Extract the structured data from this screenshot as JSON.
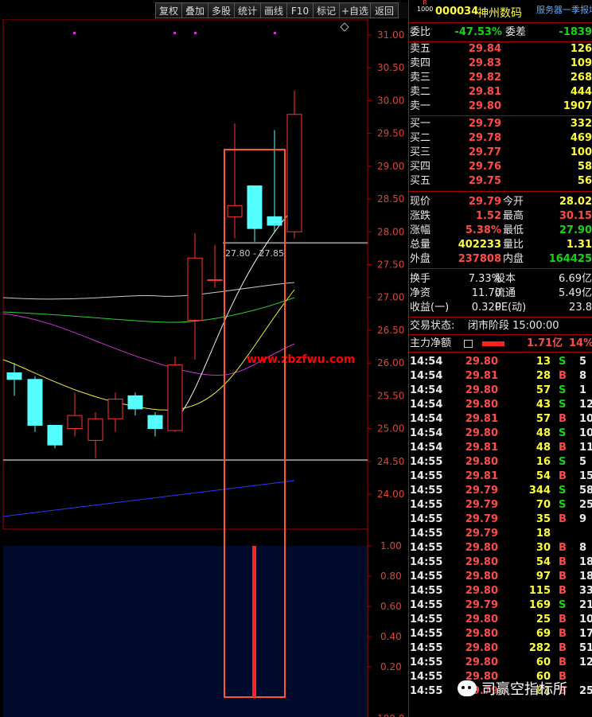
{
  "toolbar": [
    "复权",
    "叠加",
    "多股",
    "统计",
    "画线",
    "F10",
    "标记",
    "+自选",
    "返回"
  ],
  "stock": {
    "code": "000034",
    "name": "神州数码",
    "market_tag": "R\n1000",
    "server_label": "服务器一季报增"
  },
  "order_book_top": [
    {
      "label": "委比",
      "value": "-47.53%",
      "label2": "委差",
      "value2": "-1839"
    }
  ],
  "asks": [
    {
      "label": "卖五",
      "price": "29.84",
      "vol": "126"
    },
    {
      "label": "卖四",
      "price": "29.83",
      "vol": "109"
    },
    {
      "label": "卖三",
      "price": "29.82",
      "vol": "268"
    },
    {
      "label": "卖二",
      "price": "29.81",
      "vol": "444"
    },
    {
      "label": "卖一",
      "price": "29.80",
      "vol": "1907"
    }
  ],
  "bids": [
    {
      "label": "买一",
      "price": "29.79",
      "vol": "332"
    },
    {
      "label": "买二",
      "price": "29.78",
      "vol": "469"
    },
    {
      "label": "买三",
      "price": "29.77",
      "vol": "100"
    },
    {
      "label": "买四",
      "price": "29.76",
      "vol": "58"
    },
    {
      "label": "买五",
      "price": "29.75",
      "vol": "56"
    }
  ],
  "quote": [
    {
      "l1": "现价",
      "v1": "29.79",
      "l2": "今开",
      "v2": "28.02"
    },
    {
      "l1": "涨跌",
      "v1": "1.52",
      "l2": "最高",
      "v2": "30.15"
    },
    {
      "l1": "涨幅",
      "v1": "5.38%",
      "l2": "最低",
      "v2": "27.90"
    },
    {
      "l1": "总量",
      "v1": "402233",
      "l2": "量比",
      "v2": "1.31"
    },
    {
      "l1": "外盘",
      "v1": "237808",
      "l2": "内盘",
      "v2": "164425"
    }
  ],
  "stats": [
    {
      "l1": "换手",
      "v1": "7.33%",
      "l2": "股本",
      "v2": "6.69亿"
    },
    {
      "l1": "净资",
      "v1": "11.70",
      "l2": "流通",
      "v2": "5.49亿"
    },
    {
      "l1": "收益(一)",
      "v1": "0.320",
      "l2": "PE(动)",
      "v2": "23.8"
    }
  ],
  "status": {
    "label": "交易状态:",
    "value": "闭市阶段 15:00:00"
  },
  "main_flow": {
    "label": "主力净额",
    "value": "1.71亿",
    "pct": "14%"
  },
  "ticks": [
    [
      "14:54",
      "29.80",
      "13",
      "S",
      "5"
    ],
    [
      "14:54",
      "29.81",
      "28",
      "B",
      "8"
    ],
    [
      "14:54",
      "29.80",
      "57",
      "S",
      "1"
    ],
    [
      "14:54",
      "29.80",
      "43",
      "S",
      "12"
    ],
    [
      "14:54",
      "29.81",
      "57",
      "B",
      "10"
    ],
    [
      "14:54",
      "29.80",
      "48",
      "S",
      "10"
    ],
    [
      "14:54",
      "29.81",
      "48",
      "B",
      "11"
    ],
    [
      "14:55",
      "29.80",
      "16",
      "S",
      "5"
    ],
    [
      "14:55",
      "29.81",
      "54",
      "B",
      "15"
    ],
    [
      "14:55",
      "29.79",
      "344",
      "S",
      "58"
    ],
    [
      "14:55",
      "29.79",
      "70",
      "S",
      "25"
    ],
    [
      "14:55",
      "29.79",
      "35",
      "B",
      "9"
    ],
    [
      "14:55",
      "29.79",
      "18",
      "",
      ""
    ],
    [
      "14:55",
      "29.80",
      "30",
      "B",
      "8"
    ],
    [
      "14:55",
      "29.80",
      "54",
      "B",
      "18"
    ],
    [
      "14:55",
      "29.80",
      "97",
      "B",
      "18"
    ],
    [
      "14:55",
      "29.80",
      "115",
      "B",
      "33"
    ],
    [
      "14:55",
      "29.79",
      "169",
      "S",
      "21"
    ],
    [
      "14:55",
      "29.80",
      "25",
      "B",
      "10"
    ],
    [
      "14:55",
      "29.80",
      "69",
      "B",
      "17"
    ],
    [
      "14:55",
      "29.80",
      "282",
      "B",
      "51"
    ],
    [
      "14:55",
      "29.80",
      "60",
      "B",
      "12"
    ],
    [
      "14:55",
      "29.80",
      "60",
      "B",
      ""
    ],
    [
      "14:55",
      "29.79",
      "81",
      "B",
      "25"
    ]
  ],
  "chart_data": {
    "type": "candlestick",
    "price_axis_ticks": [
      "31.00",
      "30.50",
      "30.00",
      "29.50",
      "29.00",
      "28.50",
      "28.00",
      "27.50",
      "27.00",
      "26.50",
      "26.00",
      "25.50",
      "25.00",
      "24.50",
      "24.00"
    ],
    "indicator_axis_ticks": [
      "1.00",
      "0.80",
      "0.60",
      "0.40",
      "0.20"
    ],
    "bottom_tick": "100.0",
    "candles": [
      {
        "o": 25.85,
        "c": 25.75,
        "h": 26.0,
        "l": 25.5
      },
      {
        "o": 25.75,
        "c": 25.05,
        "h": 25.8,
        "l": 24.95
      },
      {
        "o": 25.05,
        "c": 24.75,
        "h": 25.05,
        "l": 24.7
      },
      {
        "o": 25.0,
        "c": 25.2,
        "h": 25.55,
        "l": 24.88
      },
      {
        "o": 24.82,
        "c": 25.15,
        "h": 25.25,
        "l": 24.55
      },
      {
        "o": 25.15,
        "c": 25.45,
        "h": 25.55,
        "l": 24.95
      },
      {
        "o": 25.5,
        "c": 25.3,
        "h": 25.55,
        "l": 25.2
      },
      {
        "o": 25.2,
        "c": 25.0,
        "h": 25.25,
        "l": 24.88
      },
      {
        "o": 24.97,
        "c": 25.97,
        "h": 26.1,
        "l": 24.95
      },
      {
        "o": 26.65,
        "c": 27.6,
        "h": 27.98,
        "l": 26.05
      },
      {
        "o": 27.27,
        "c": 27.27,
        "h": 27.8,
        "l": 27.15
      },
      {
        "o": 28.23,
        "c": 28.4,
        "h": 29.65,
        "l": 27.9
      },
      {
        "o": 28.7,
        "c": 28.05,
        "h": 28.7,
        "l": 27.85
      },
      {
        "o": 28.23,
        "c": 28.1,
        "h": 29.55,
        "l": 28.0
      },
      {
        "o": 28.0,
        "c": 29.79,
        "h": 30.15,
        "l": 27.9
      }
    ],
    "annotation": "27.80 - 27.85",
    "watermark": "www.zbzfwu.com",
    "indicator_value": 1.0
  },
  "watermark_text": "司赢空指标所"
}
